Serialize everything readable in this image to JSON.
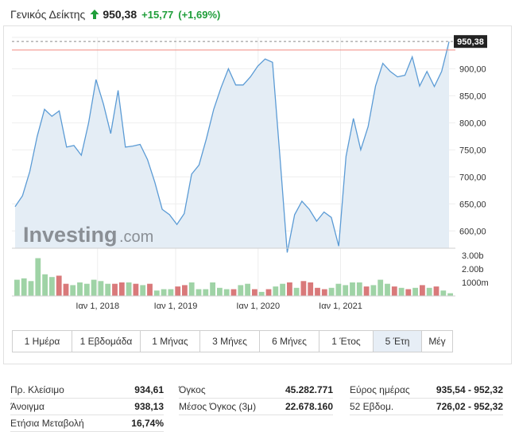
{
  "header": {
    "title": "Γενικός Δείκτης",
    "price": "950,38",
    "change": "+15,77",
    "change_pct": "(+1,69%)",
    "trend": "up"
  },
  "colors": {
    "up": "#1f9e3a",
    "down": "#d9534f",
    "line": "#5b9bd5",
    "area": "#e4edf5",
    "ref_line": "#f08a80"
  },
  "chart_data": [
    {
      "type": "area",
      "title": "",
      "xlabel": "",
      "ylabel": "",
      "x_ticks": [
        {
          "label": "Ιαν 1, 2018",
          "t": 0.19
        },
        {
          "label": "Ιαν 1, 2019",
          "t": 0.37
        },
        {
          "label": "Ιαν 1, 2020",
          "t": 0.56
        },
        {
          "label": "Ιαν 1, 2021",
          "t": 0.75
        }
      ],
      "y_ticks": [
        600,
        650,
        700,
        750,
        800,
        850,
        900
      ],
      "ylim": [
        568,
        958
      ],
      "grid": true,
      "last_value_label": "950,38",
      "last_value": 950.38,
      "reference_value": 934.61,
      "series": [
        {
          "values": [
            645,
            665,
            710,
            775,
            825,
            812,
            822,
            755,
            758,
            740,
            800,
            880,
            835,
            780,
            860,
            755,
            757,
            760,
            732,
            690,
            640,
            630,
            612,
            632,
            705,
            722,
            770,
            825,
            865,
            900,
            870,
            870,
            885,
            905,
            918,
            912,
            738,
            560,
            630,
            655,
            640,
            618,
            635,
            625,
            572,
            738,
            808,
            750,
            793,
            868,
            910,
            895,
            885,
            888,
            922,
            868,
            895,
            867,
            895,
            950
          ]
        }
      ]
    },
    {
      "type": "bar",
      "title": "",
      "y_ticks": [
        "3.00b",
        "2.00b",
        "1000m"
      ],
      "ylim": [
        0,
        3.3
      ],
      "series": [
        {
          "values": [
            1.2,
            1.3,
            1.1,
            2.8,
            1.6,
            1.4,
            1.5,
            0.9,
            0.8,
            1.0,
            0.9,
            1.2,
            1.1,
            0.9,
            0.9,
            1.0,
            1.0,
            0.9,
            0.8,
            0.9,
            0.4,
            0.5,
            0.5,
            0.7,
            0.8,
            1.0,
            0.5,
            0.5,
            1.0,
            0.6,
            0.5,
            0.5,
            0.8,
            0.9,
            0.5,
            0.3,
            0.5,
            0.7,
            0.9,
            1.0,
            0.6,
            1.1,
            1.0,
            0.6,
            0.5,
            0.6,
            0.9,
            0.8,
            1.0,
            1.0,
            0.7,
            0.8,
            1.2,
            0.9,
            0.7,
            0.6,
            0.5,
            0.6,
            0.8,
            0.6,
            0.7,
            0.4,
            0.2
          ],
          "up": [
            true,
            true,
            true,
            true,
            true,
            true,
            false,
            false,
            true,
            true,
            true,
            true,
            true,
            true,
            false,
            false,
            true,
            false,
            true,
            false,
            true,
            true,
            true,
            false,
            false,
            true,
            true,
            true,
            true,
            true,
            true,
            false,
            true,
            true,
            false,
            true,
            false,
            true,
            true,
            false,
            true,
            false,
            false,
            false,
            false,
            true,
            true,
            true,
            true,
            true,
            false,
            true,
            true,
            true,
            false,
            true,
            false,
            true,
            false,
            true,
            false,
            true,
            true
          ]
        }
      ]
    }
  ],
  "watermark": {
    "brand": "Investing",
    "suffix": ".com"
  },
  "ranges": [
    {
      "label": "1 Ημέρα",
      "active": false
    },
    {
      "label": "1 Εβδομάδα",
      "active": false
    },
    {
      "label": "1 Μήνας",
      "active": false
    },
    {
      "label": "3 Μήνες",
      "active": false
    },
    {
      "label": "6 Μήνες",
      "active": false
    },
    {
      "label": "1 Έτος",
      "active": false
    },
    {
      "label": "5 Έτη",
      "active": true
    },
    {
      "label": "Μέγ",
      "active": false
    }
  ],
  "stats": {
    "col1": [
      {
        "label": "Πρ. Κλείσιμο",
        "value": "934,61"
      },
      {
        "label": "Άνοιγμα",
        "value": "938,13"
      },
      {
        "label": "Ετήσια Μεταβολή",
        "value": "16,74%"
      }
    ],
    "col2": [
      {
        "label": "Όγκος",
        "value": "45.282.771"
      },
      {
        "label": "Μέσος Όγκος (3μ)",
        "value": "22.678.160"
      }
    ],
    "col3": [
      {
        "label": "Εύρος ημέρας",
        "value": "935,54 - 952,32"
      },
      {
        "label": "52 Εβδομ.",
        "value": "726,02 - 952,32"
      }
    ]
  }
}
